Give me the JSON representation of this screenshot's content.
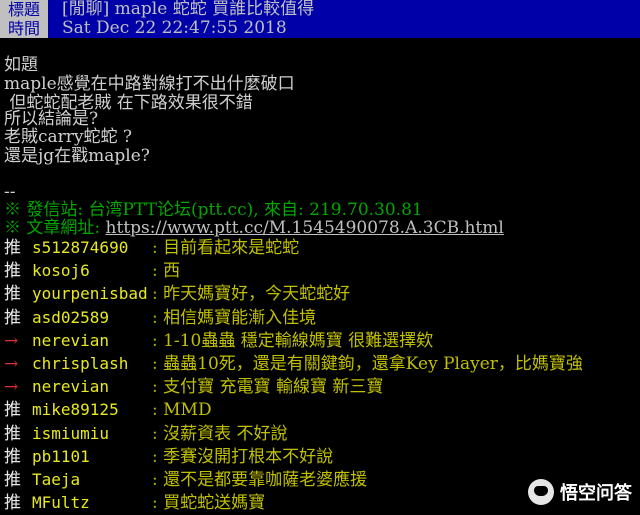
{
  "header": {
    "title_label": "標題",
    "title_value": "[閒聊] maple 蛇蛇 買誰比較值得",
    "time_label": "時間",
    "time_value": "Sat Dec 22 22:47:55 2018"
  },
  "body_lines": [
    "如題",
    "maple感覺在中路對線打不出什麼破口",
    " 但蛇蛇配老賊 在下路效果很不錯",
    "所以結論是?",
    "老賊carry蛇蛇 ?",
    "還是jg在戳maple?"
  ],
  "signature": {
    "separator": "--",
    "origin_prefix": "※ 發信站: 台湾PTT论坛(ptt.cc), 來自: 219.70.30.81",
    "url_prefix": "※ 文章網址: ",
    "url": "https://www.ptt.cc/M.1545490078.A.3CB.html"
  },
  "pushes": [
    {
      "tag": "推",
      "user": "s512874690",
      "text": "目前看起來是蛇蛇"
    },
    {
      "tag": "推",
      "user": "kosoj6",
      "text": "西"
    },
    {
      "tag": "推",
      "user": "yourpenisbad",
      "text": "昨天媽寶好，今天蛇蛇好"
    },
    {
      "tag": "推",
      "user": "asd02589",
      "text": "相信媽寶能漸入佳境"
    },
    {
      "tag": "→",
      "user": "nerevian",
      "text": "1-10蟲蟲 穩定輸線媽寶 很難選擇欸"
    },
    {
      "tag": "→",
      "user": "chrisplash",
      "text": "蟲蟲10死，還是有關鍵鉤，還拿Key Player，比媽寶強"
    },
    {
      "tag": "→",
      "user": "nerevian",
      "text": "支付寶 充電寶 輸線寶 新三寶"
    },
    {
      "tag": "推",
      "user": "mike89125",
      "text": "MMD"
    },
    {
      "tag": "推",
      "user": "ismiumiu",
      "text": "沒薪資表 不好說"
    },
    {
      "tag": "推",
      "user": "pb1101",
      "text": "季賽沒開打根本不好說"
    },
    {
      "tag": "推",
      "user": "Taeja",
      "text": "還不是都要靠咖薩老婆應援"
    },
    {
      "tag": "推",
      "user": "MFultz",
      "text": "買蛇蛇送媽寶"
    }
  ],
  "watermark": "悟空问答"
}
